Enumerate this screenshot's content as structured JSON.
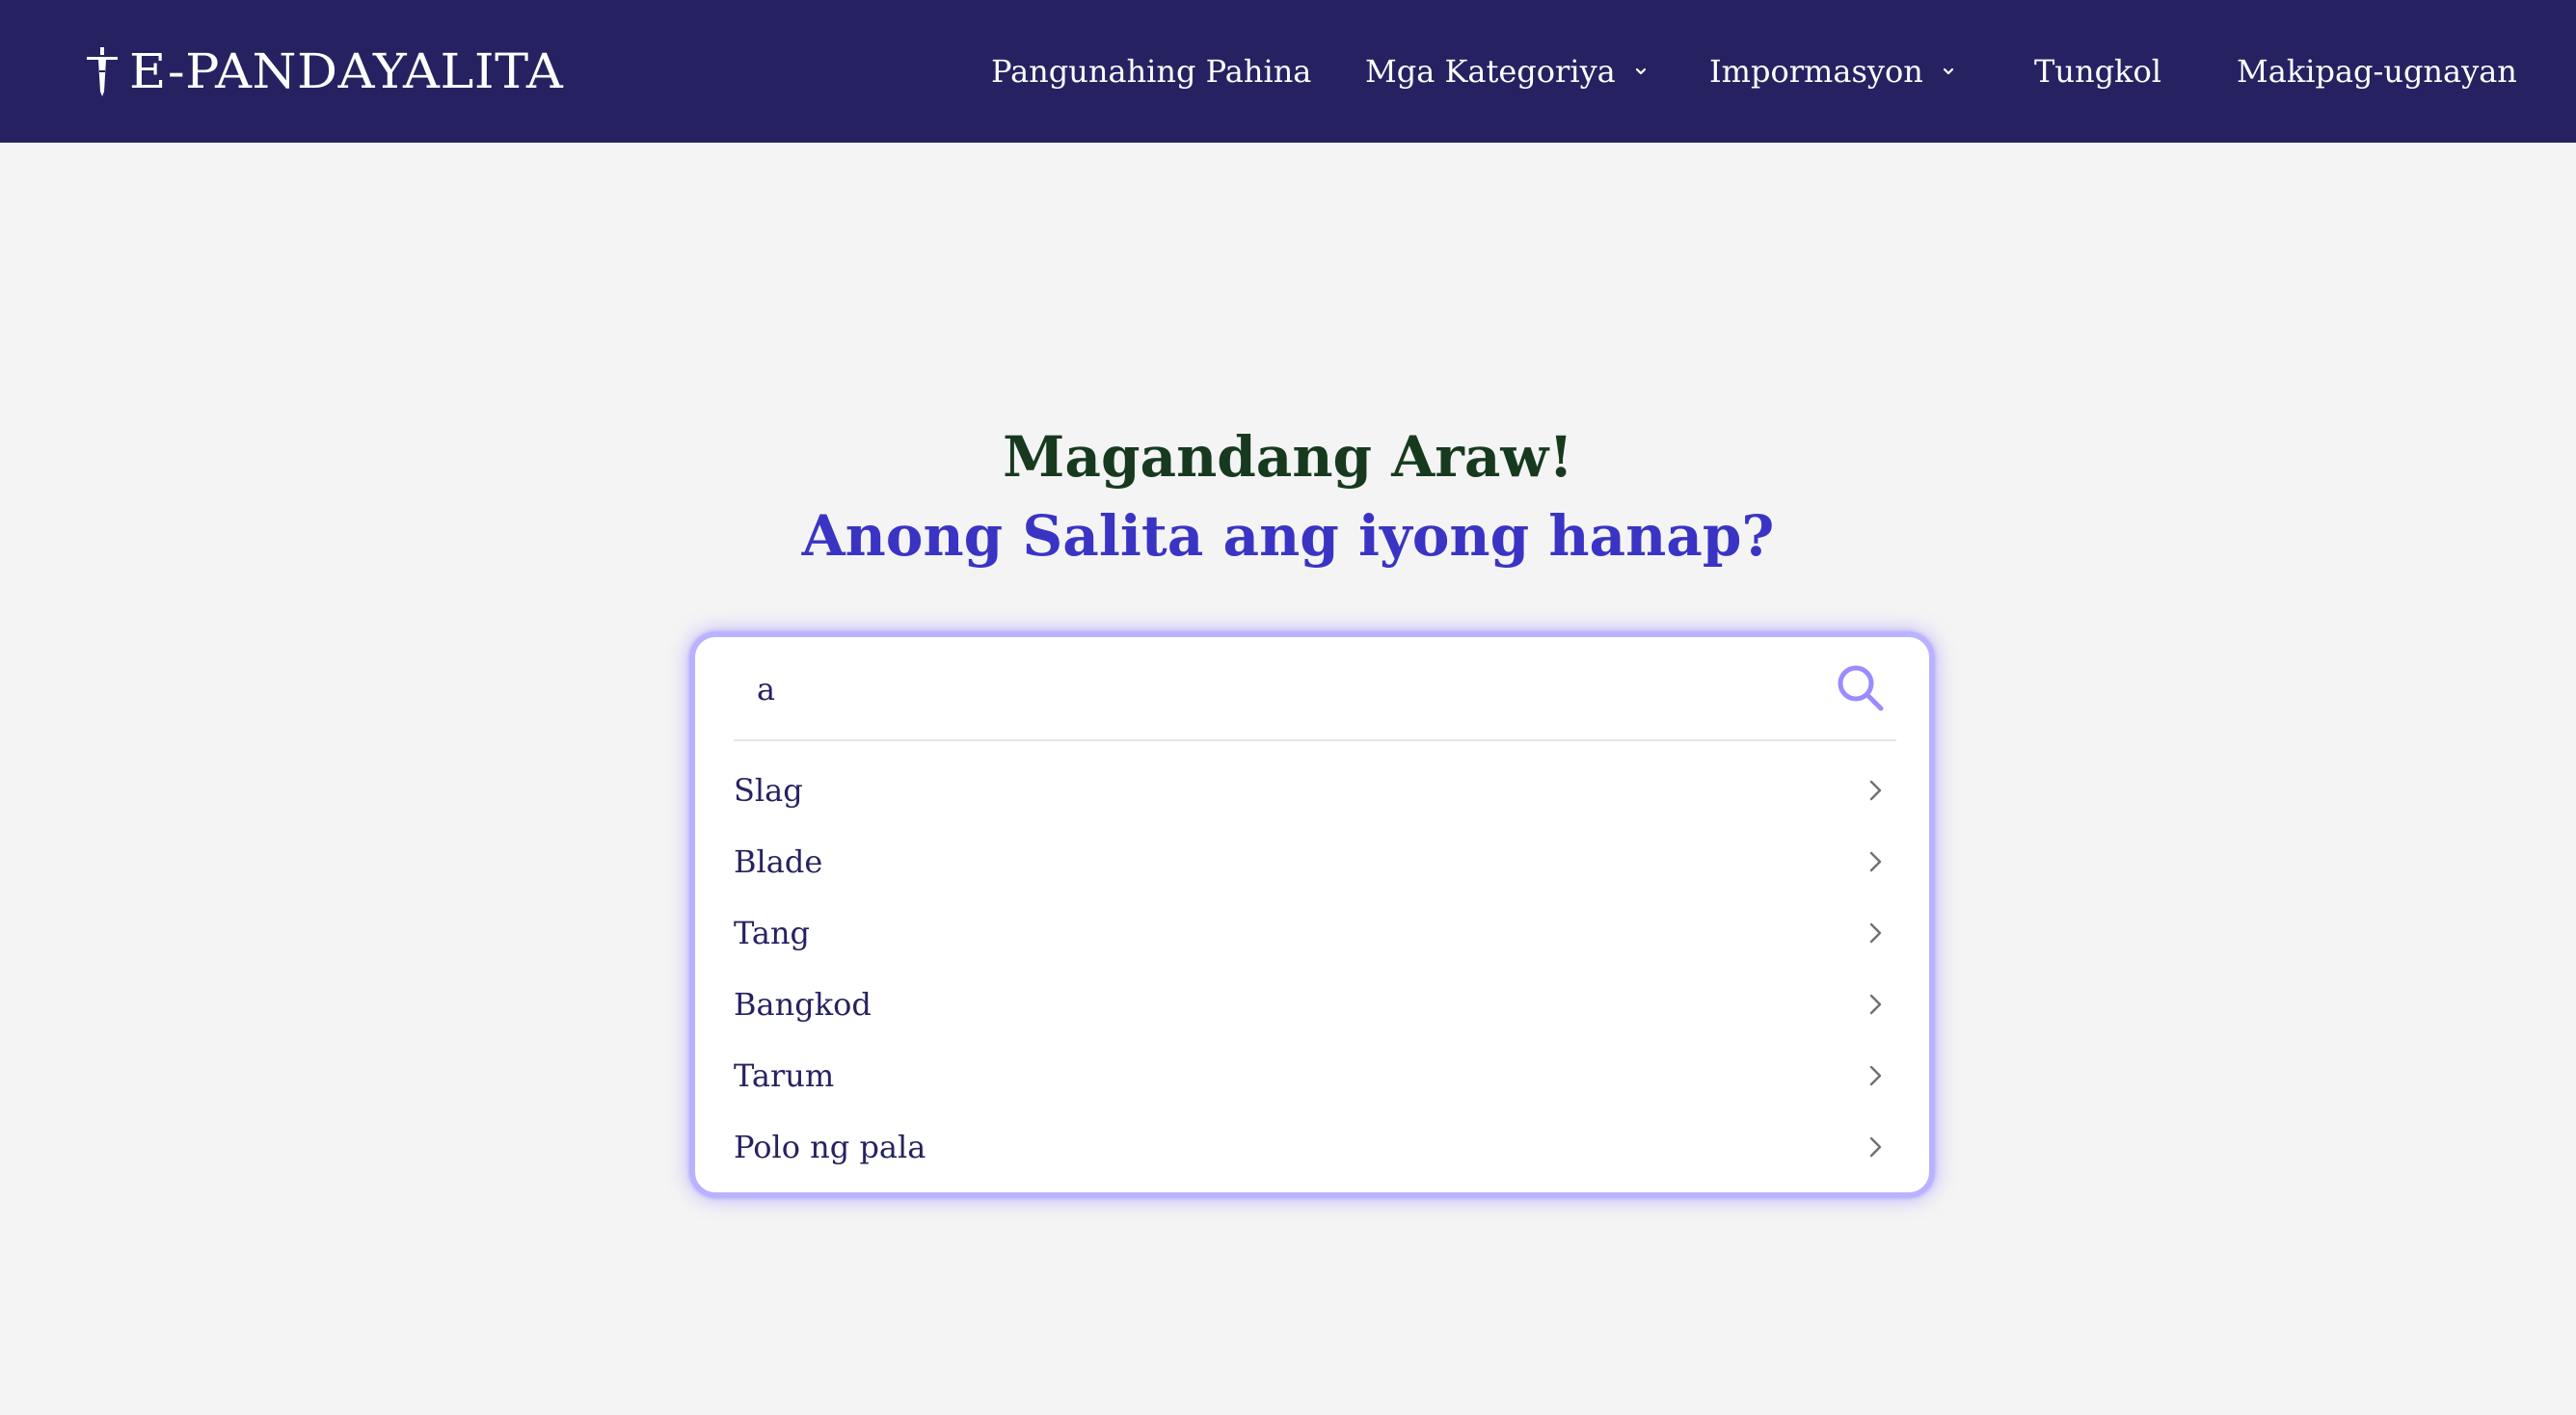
{
  "header": {
    "logo_text": "E-PANDAYALITA",
    "nav": [
      {
        "label": "Pangunahing Pahina",
        "has_dropdown": false
      },
      {
        "label": "Mga Kategoriya",
        "has_dropdown": true
      },
      {
        "label": "Impormasyon",
        "has_dropdown": true
      },
      {
        "label": "Tungkol",
        "has_dropdown": false
      },
      {
        "label": "Makipag-ugnayan",
        "has_dropdown": false
      }
    ]
  },
  "hero": {
    "greeting": "Magandang Araw!",
    "prompt": "Anong Salita ang iyong hanap?"
  },
  "search": {
    "value": "a",
    "placeholder": "",
    "suggestions": [
      {
        "label": "Slag"
      },
      {
        "label": "Blade"
      },
      {
        "label": "Tang"
      },
      {
        "label": "Bangkod"
      },
      {
        "label": "Tarum"
      },
      {
        "label": "Polo ng pala"
      }
    ]
  },
  "colors": {
    "navbar_bg": "#262262",
    "greeting": "#173a1f",
    "prompt": "#3a34c4",
    "accent": "#9a8cff",
    "suggestion_text": "#262262",
    "page_bg": "#f4f4f4"
  },
  "icons": {
    "logo": "dagger-icon",
    "dropdown": "chevron-down-icon",
    "search": "search-icon",
    "suggestion": "chevron-right-icon"
  }
}
